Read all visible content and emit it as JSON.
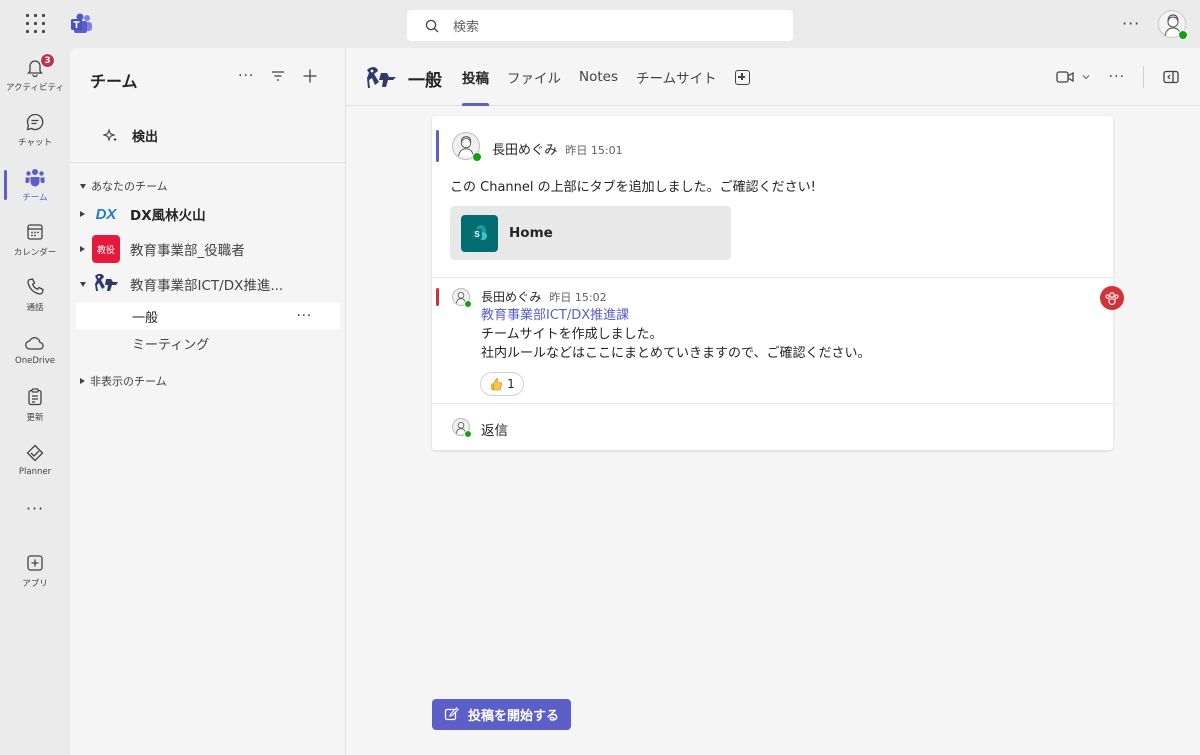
{
  "search": {
    "placeholder": "検索"
  },
  "topbar": {
    "more": "···"
  },
  "rail": {
    "items": [
      {
        "label": "アクティビティ",
        "icon": "bell-icon",
        "badge": "3"
      },
      {
        "label": "チャット",
        "icon": "chat-icon"
      },
      {
        "label": "チーム",
        "icon": "teams-icon",
        "active": true
      },
      {
        "label": "カレンダー",
        "icon": "calendar-icon"
      },
      {
        "label": "通話",
        "icon": "phone-icon"
      },
      {
        "label": "OneDrive",
        "icon": "cloud-icon"
      },
      {
        "label": "更新",
        "icon": "clipboard-icon"
      },
      {
        "label": "Planner",
        "icon": "planner-icon"
      },
      {
        "label": "",
        "icon": "more-icon"
      },
      {
        "label": "アプリ",
        "icon": "add-apps-icon"
      }
    ],
    "more_dots": "···"
  },
  "teams_pane": {
    "title": "チーム",
    "more": "···",
    "detect_label": "検出",
    "your_teams_header": "あなたのチーム",
    "teams": [
      {
        "name": "DX風林火山",
        "icon_text": "DX",
        "bold": true
      },
      {
        "name": "教育事業部_役職者",
        "icon_text": "教役"
      },
      {
        "name": "教育事業部ICT/DX推進...",
        "expanded": true
      }
    ],
    "channels": [
      {
        "name": "一般",
        "active": true,
        "more": "···"
      },
      {
        "name": "ミーティング"
      }
    ],
    "hidden_teams_header": "非表示のチーム"
  },
  "channel": {
    "title": "一般",
    "tabs": [
      "投稿",
      "ファイル",
      "Notes",
      "チームサイト"
    ],
    "active_tab": "投稿",
    "more": "···"
  },
  "posts": {
    "msg1": {
      "author": "長田めぐみ",
      "time": "昨日 15:01",
      "text": "この Channel の上部にタブを追加しました。ご確認ください!",
      "tab_card": "Home",
      "accent": "#5b5fc7"
    },
    "msg2": {
      "author": "長田めぐみ",
      "time": "昨日 15:02",
      "mention": "教育事業部ICT/DX推進課",
      "line1": "チームサイトを作成しました。",
      "line2": "社内ルールなどはここにまとめていきますので、ご確認ください。",
      "reaction_count": "1",
      "accent": "#d13438"
    },
    "reply_label": "返信"
  },
  "new_post_label": "投稿を開始する"
}
